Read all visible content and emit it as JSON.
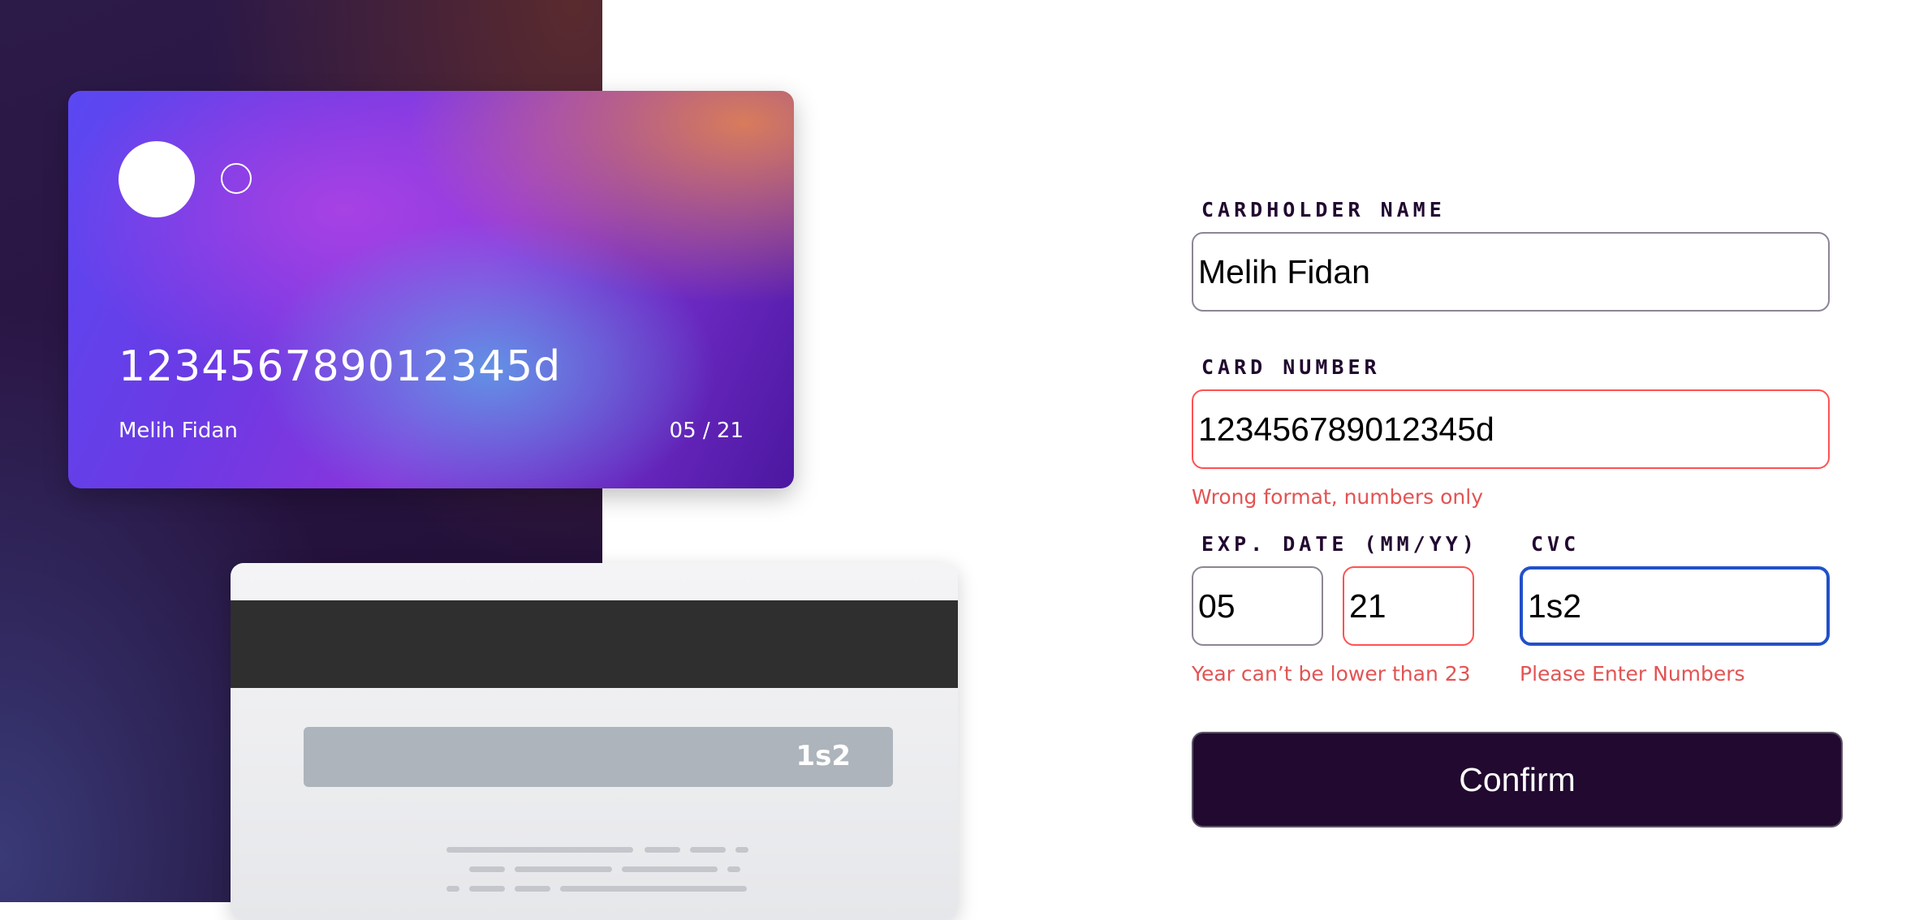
{
  "card_front": {
    "number": "123456789012345d",
    "name": "Melih Fidan",
    "expiry": "05 / 21"
  },
  "card_back": {
    "cvc": "1s2"
  },
  "form": {
    "name_label": "CARDHOLDER NAME",
    "name_value": "Melih Fidan",
    "number_label": "CARD NUMBER",
    "number_value": "123456789012345d",
    "number_error": "Wrong format, numbers only",
    "exp_label": "EXP. DATE (MM/YY)",
    "exp_month_value": "05",
    "exp_year_value": "21",
    "exp_error": "Year can’t be lower than 23",
    "cvc_label": "CVC",
    "cvc_value": "1s2",
    "cvc_error": "Please Enter Numbers",
    "confirm_label": "Confirm"
  },
  "colors": {
    "dark_violet": "#21092f",
    "error_red": "#ff5252",
    "focus_blue": "#2250c8"
  }
}
